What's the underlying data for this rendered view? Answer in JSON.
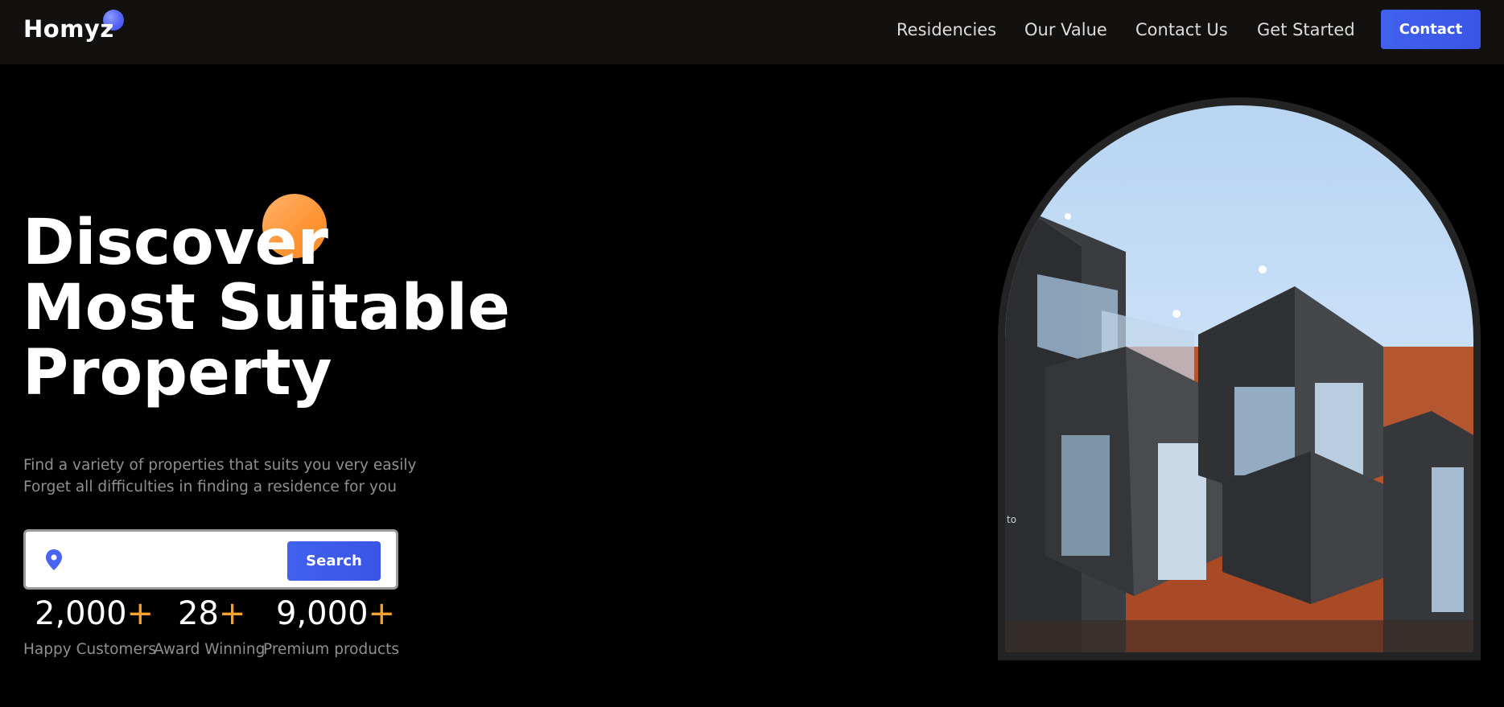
{
  "brand": {
    "name": "Homyz",
    "dot_color": "#5363f7"
  },
  "nav": {
    "items": [
      {
        "label": "Residencies"
      },
      {
        "label": "Our Value"
      },
      {
        "label": "Contact Us"
      },
      {
        "label": "Get Started"
      }
    ],
    "contact_label": "Contact"
  },
  "hero": {
    "title_lines": [
      "Discover",
      "Most Suitable",
      "Property"
    ],
    "subtitle_lines": [
      "Find a variety of properties that suits you very easily",
      "Forget all difficulties in finding a residence for you"
    ],
    "search": {
      "placeholder": "",
      "value": "",
      "button_label": "Search"
    },
    "stats": [
      {
        "value": "2,000",
        "plus": "+",
        "label": "Happy Customers"
      },
      {
        "value": "28",
        "plus": "+",
        "label": "Award Winning"
      },
      {
        "value": "9,000",
        "plus": "+",
        "label": "Premium products"
      }
    ]
  },
  "image": {
    "overlay_text": "to"
  },
  "colors": {
    "accent": "#4161ef",
    "orange": "#f9a12d",
    "header_bg": "#131110",
    "page_bg": "#000000"
  }
}
